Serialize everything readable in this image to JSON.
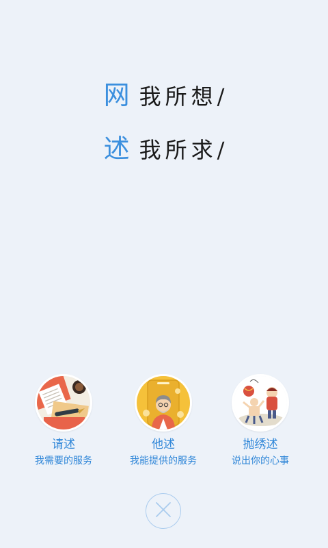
{
  "slogans": [
    {
      "accent": "网",
      "text": "我所想",
      "slash": "/"
    },
    {
      "accent": "述",
      "text": "我所求",
      "slash": "/"
    }
  ],
  "options": [
    {
      "title": "请述",
      "subtitle": "我需要的服务",
      "icon": "writing-illustration-icon"
    },
    {
      "title": "他述",
      "subtitle": "我能提供的服务",
      "icon": "old-man-illustration-icon"
    },
    {
      "title": "抛绣述",
      "subtitle": "说出你的心事",
      "icon": "ball-throwing-illustration-icon"
    }
  ],
  "close": {
    "icon": "close-icon"
  },
  "colors": {
    "background": "#edf2f9",
    "accent": "#3b8fde",
    "link": "#2f86d8"
  }
}
